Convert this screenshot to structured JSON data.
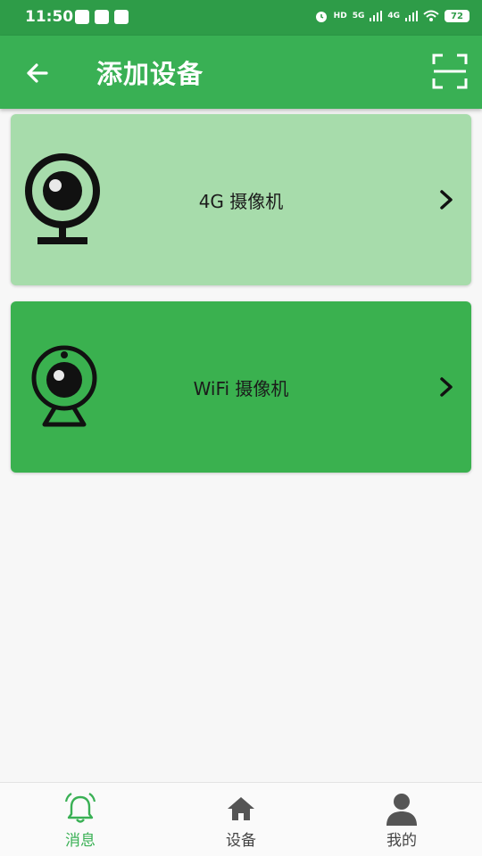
{
  "status_bar": {
    "time": "11:50",
    "net1": "HD",
    "net2": "5G",
    "net3": "4G",
    "battery": "72"
  },
  "app_bar": {
    "title": "添加设备"
  },
  "devices": [
    {
      "label": "4G 摄像机",
      "icon": "webcam-4g-icon"
    },
    {
      "label": "WiFi 摄像机",
      "icon": "webcam-wifi-icon"
    }
  ],
  "bottom_nav": {
    "items": [
      {
        "label": "消息",
        "icon": "bell-icon",
        "active": true
      },
      {
        "label": "设备",
        "icon": "home-icon",
        "active": false
      },
      {
        "label": "我的",
        "icon": "person-icon",
        "active": false
      }
    ]
  },
  "colors": {
    "status_bar": "#2e9c48",
    "app_bar": "#39b054",
    "card_4g": "#a7dcab",
    "card_wifi": "#3ab14f",
    "active_nav": "#39b054"
  }
}
